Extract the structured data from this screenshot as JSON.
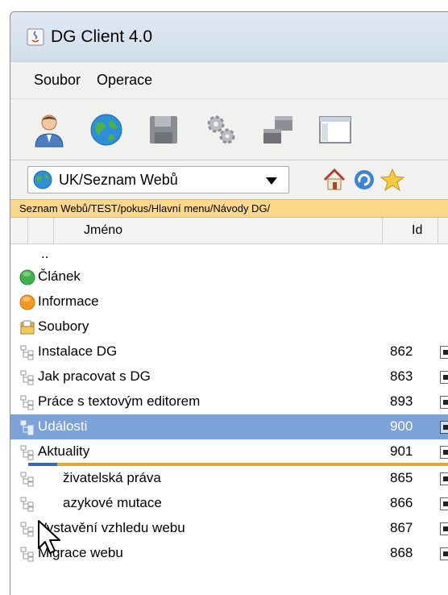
{
  "window": {
    "title": "DG Client 4.0",
    "app_icon": "java-icon"
  },
  "menu": [
    {
      "label": "Soubor"
    },
    {
      "label": "Operace"
    }
  ],
  "toolbar": {
    "icons": [
      "user-icon",
      "globe-icon",
      "save-icon",
      "settings-icon",
      "windows-icon",
      "layout-icon"
    ]
  },
  "nav": {
    "selected_site": "UK/Seznam Webů",
    "icons": [
      "home-icon",
      "refresh-icon",
      "star-icon"
    ]
  },
  "path": "Seznam Webů/TEST/pokus/Hlavní menu/Návody DG/",
  "columns": {
    "name": "Jméno",
    "id": "Id"
  },
  "rows": [
    {
      "label": "..",
      "id": "",
      "icon": "parent-dir",
      "box": false
    },
    {
      "label": "Článek",
      "id": "",
      "icon": "green-circle-icon",
      "box": false
    },
    {
      "label": "Informace",
      "id": "",
      "icon": "orange-circle-icon",
      "box": false
    },
    {
      "label": "Soubory",
      "id": "",
      "icon": "folder-icon",
      "box": false
    },
    {
      "label": "Instalace DG",
      "id": "862",
      "icon": "tree-icon",
      "box": true
    },
    {
      "label": "Jak pracovat s DG",
      "id": "863",
      "icon": "tree-icon",
      "box": true
    },
    {
      "label": "Práce s textovým editorem",
      "id": "893",
      "icon": "tree-icon",
      "box": true
    },
    {
      "label": "Události",
      "id": "900",
      "icon": "tree-icon",
      "box": true,
      "selected": true
    },
    {
      "label": "Aktuality",
      "id": "901",
      "icon": "tree-icon",
      "box": true
    },
    {
      "label": "živatelská práva",
      "id": "865",
      "icon": "tree-icon",
      "box": true
    },
    {
      "label": "azykové mutace",
      "id": "866",
      "icon": "tree-icon",
      "box": true
    },
    {
      "label": "Vystavění vzhledu webu",
      "id": "867",
      "icon": "tree-icon",
      "box": true
    },
    {
      "label": "Migrace webu",
      "id": "868",
      "icon": "tree-icon",
      "box": true
    }
  ],
  "colors": {
    "selection": "#7ca2d8",
    "path_bar": "#fbd889",
    "drop_line": "#e0a838"
  }
}
